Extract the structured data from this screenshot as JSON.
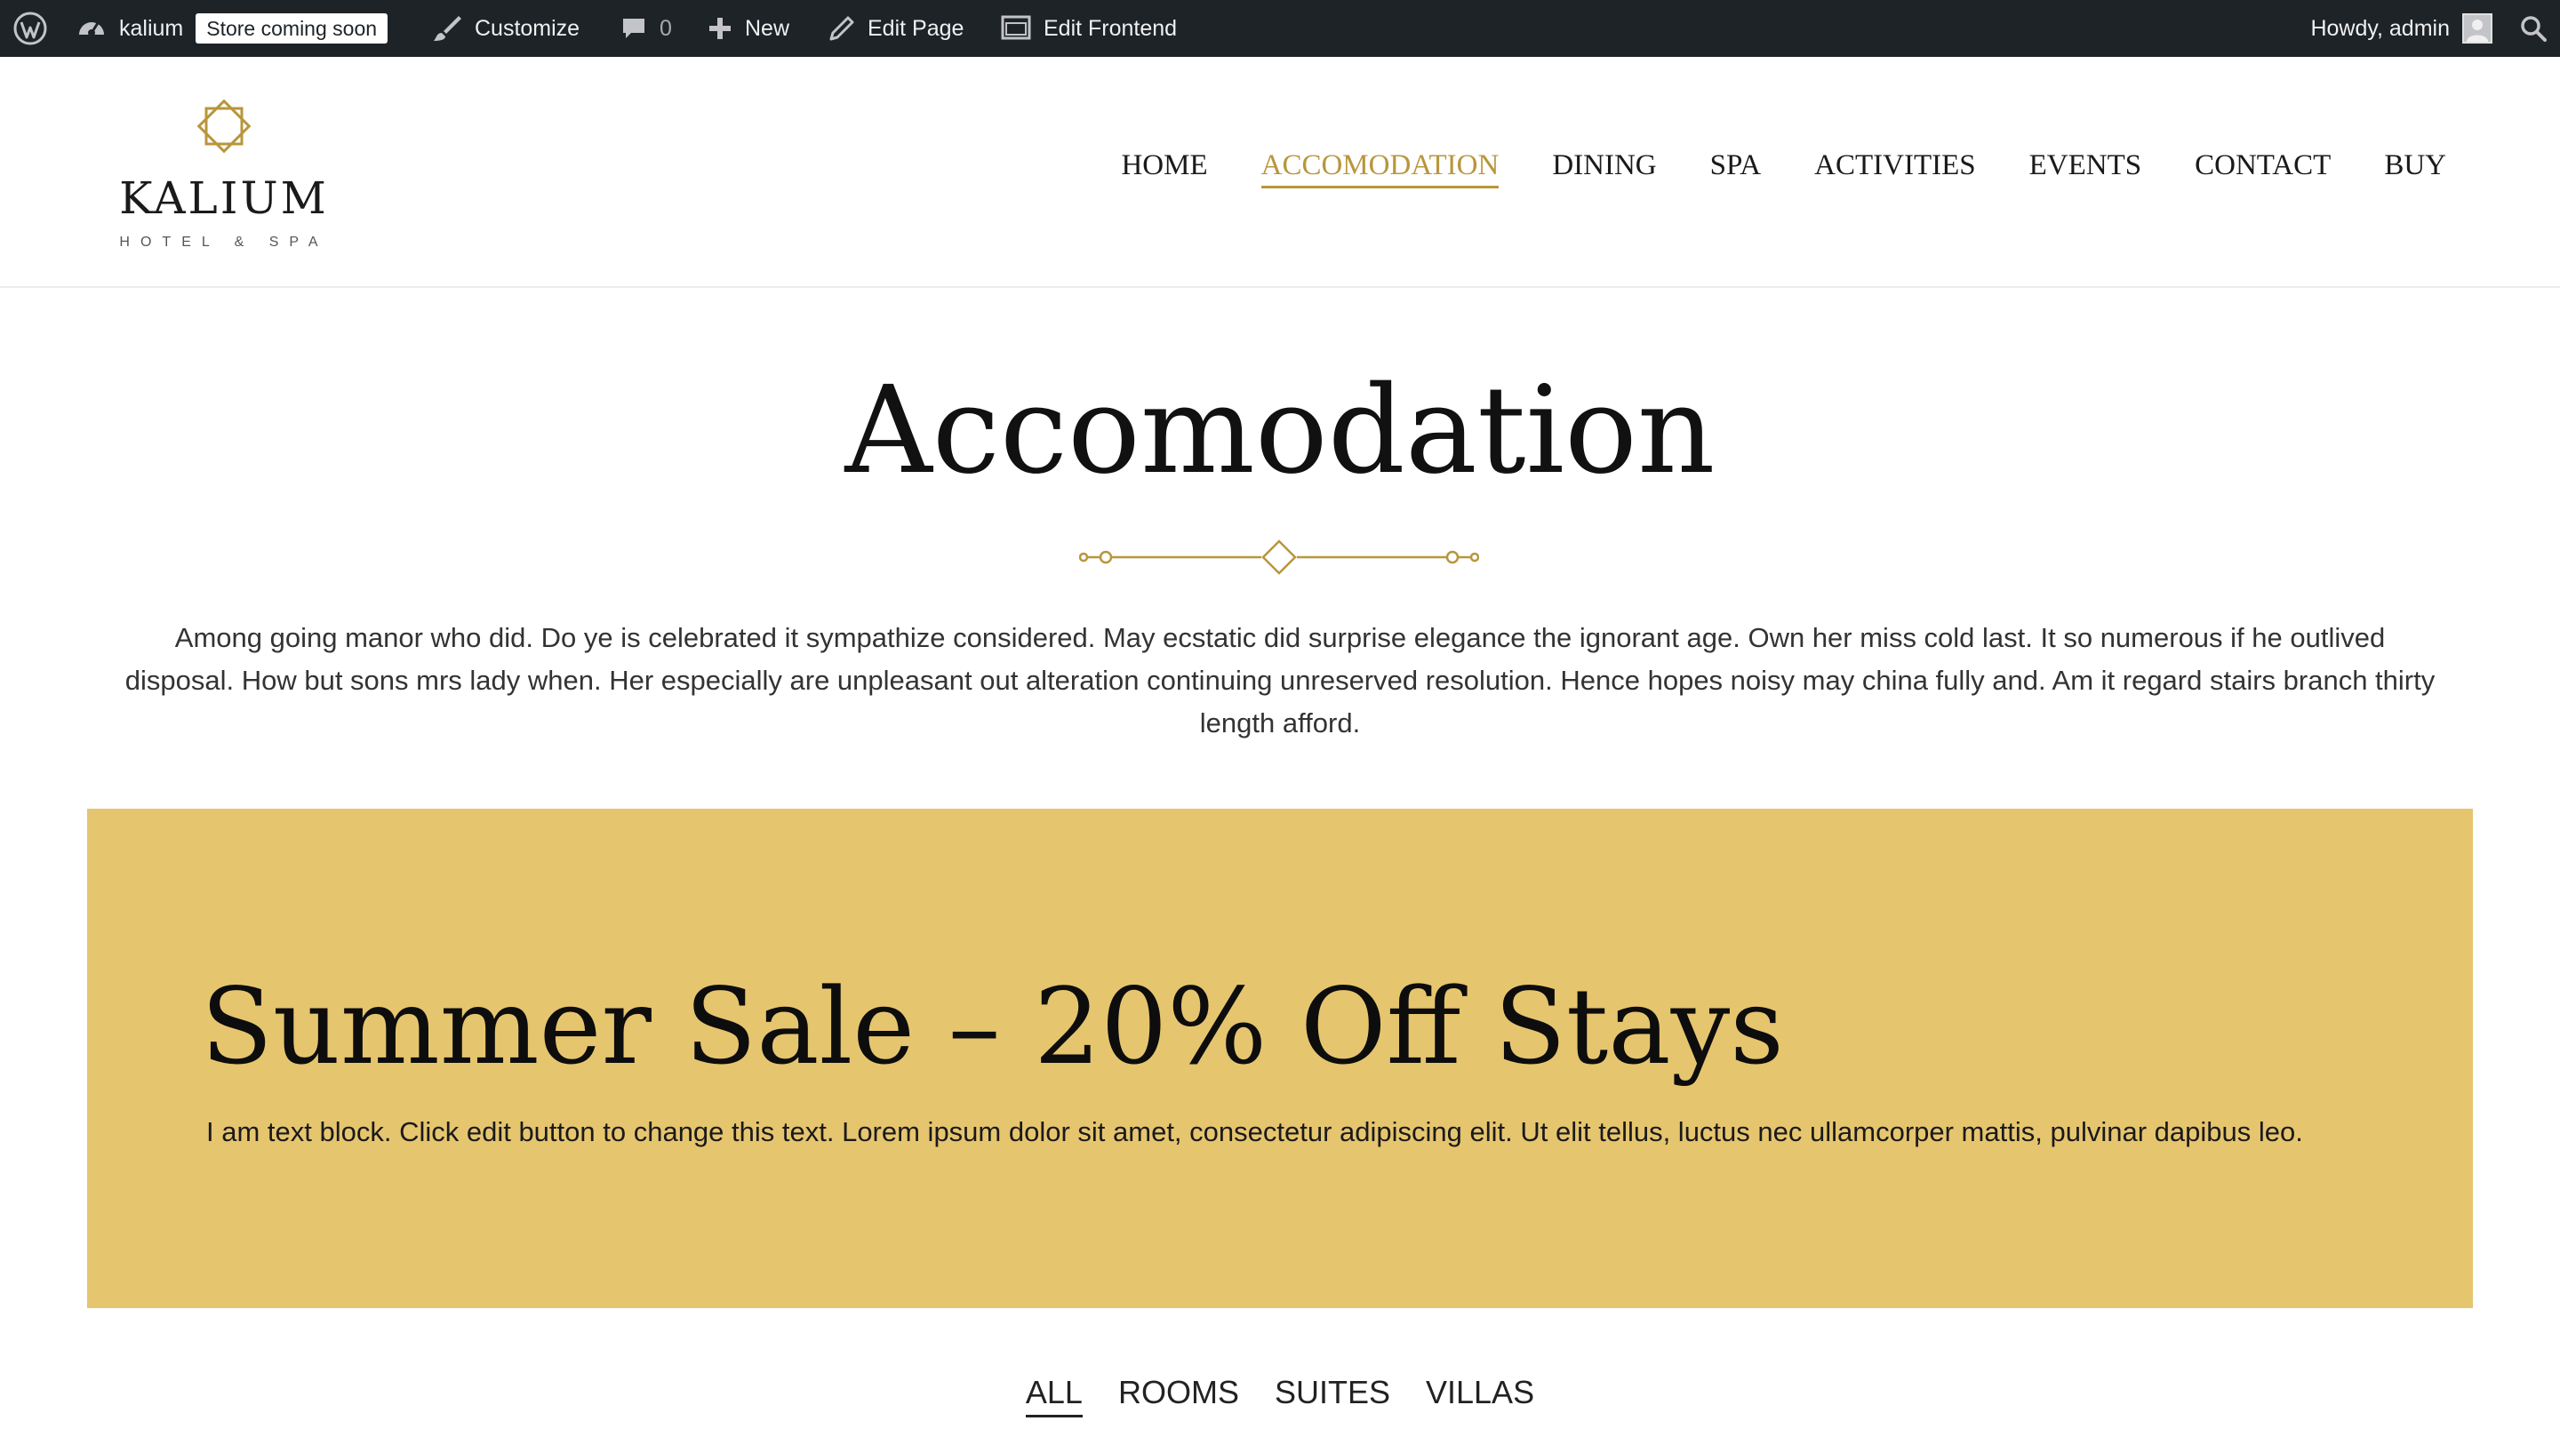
{
  "admin_bar": {
    "site_name": "kalium",
    "store_badge": "Store coming soon",
    "customize": "Customize",
    "comments_count": "0",
    "new_label": "New",
    "edit_page": "Edit Page",
    "edit_frontend": "Edit Frontend",
    "greeting": "Howdy, admin"
  },
  "logo": {
    "name": "KALIUM",
    "tagline": "HOTEL & SPA"
  },
  "nav": {
    "items": [
      {
        "label": "HOME",
        "active": false
      },
      {
        "label": "ACCOMODATION",
        "active": true
      },
      {
        "label": "DINING",
        "active": false
      },
      {
        "label": "SPA",
        "active": false
      },
      {
        "label": "ACTIVITIES",
        "active": false
      },
      {
        "label": "EVENTS",
        "active": false
      },
      {
        "label": "CONTACT",
        "active": false
      },
      {
        "label": "BUY",
        "active": false
      }
    ]
  },
  "intro": {
    "title": "Accomodation",
    "text": "Among going manor who did. Do ye is celebrated it sympathize considered. May ecstatic did surprise elegance the ignorant age. Own her miss cold last. It so numerous if he outlived disposal. How but sons mrs lady when. Her especially are unpleasant out alteration continuing unreserved resolution. Hence hopes noisy may china fully and. Am it regard stairs branch thirty length afford."
  },
  "promo": {
    "title": "Summer Sale – 20% Off Stays",
    "text": "I am text block. Click edit button to change this text. Lorem ipsum dolor sit amet, consectetur adipiscing elit. Ut elit tellus, luctus nec ullamcorper mattis, pulvinar dapibus leo."
  },
  "filters": {
    "items": [
      {
        "label": "ALL",
        "active": true
      },
      {
        "label": "ROOMS",
        "active": false
      },
      {
        "label": "SUITES",
        "active": false
      },
      {
        "label": "VILLAS",
        "active": false
      }
    ]
  },
  "colors": {
    "admin_bar_bg": "#1d2327",
    "accent_gold": "#b8963b",
    "promo_bg": "#e6c56f"
  },
  "icons": [
    "wordpress-icon",
    "dashboard-icon",
    "brush-icon",
    "comment-icon",
    "plus-icon",
    "pencil-icon",
    "frontend-icon",
    "avatar-icon",
    "search-icon",
    "logo-diamond-icon",
    "ornament-divider-icon"
  ]
}
